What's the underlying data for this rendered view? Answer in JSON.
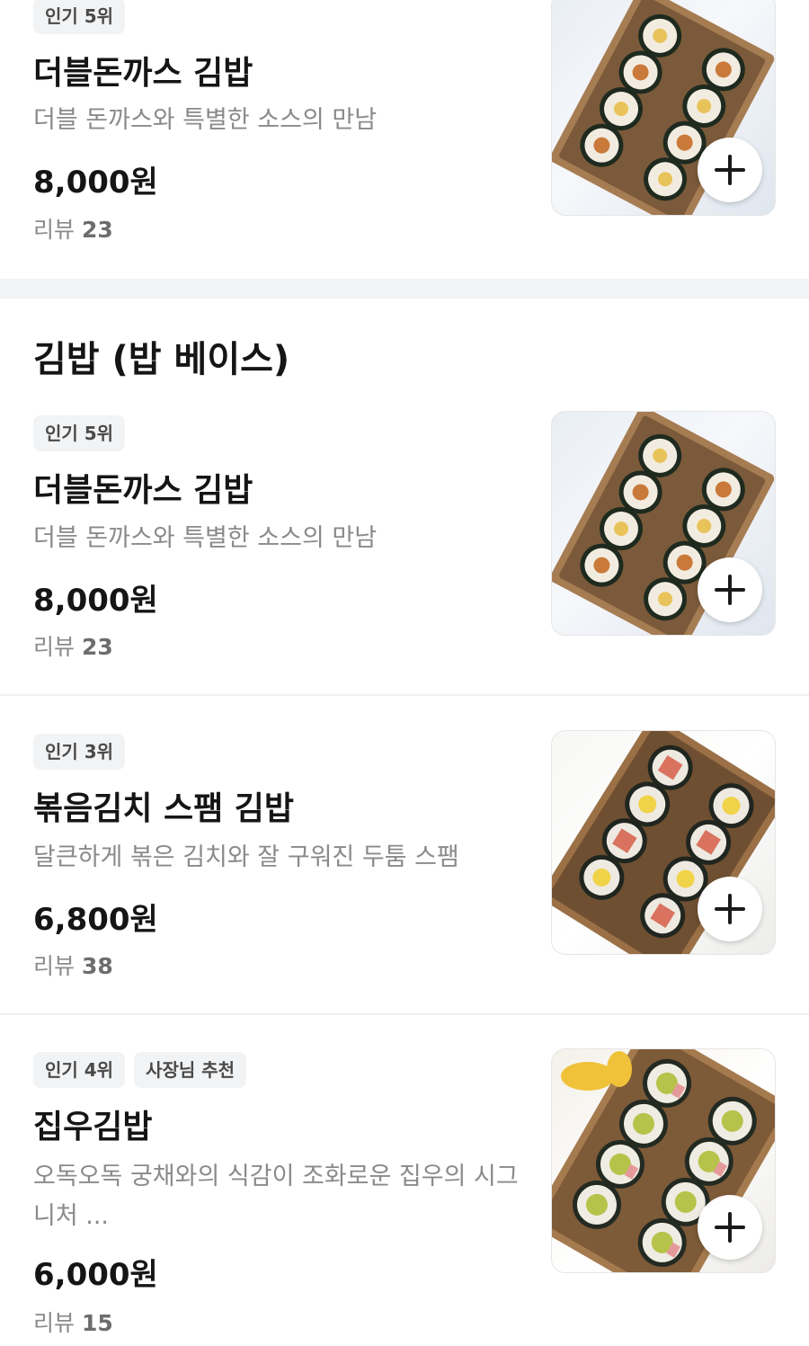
{
  "items_top": {
    "badge": "인기 5위",
    "name": "더블돈까스 김밥",
    "desc": "더블 돈까스와 특별한 소스의 만남",
    "price": "8,000원",
    "review_label": "리뷰",
    "review_count": "23"
  },
  "section": {
    "title": "김밥 (밥 베이스)"
  },
  "items": [
    {
      "badges": [
        "인기 5위"
      ],
      "name": "더블돈까스 김밥",
      "desc": "더블 돈까스와 특별한 소스의 만남",
      "price": "8,000원",
      "review_label": "리뷰",
      "review_count": "23"
    },
    {
      "badges": [
        "인기 3위"
      ],
      "name": "볶음김치 스팸 김밥",
      "desc": "달큰하게 볶은 김치와 잘 구워진 두툼 스팸",
      "price": "6,800원",
      "review_label": "리뷰",
      "review_count": "38"
    },
    {
      "badges": [
        "인기 4위",
        "사장님 추천"
      ],
      "name": "집우김밥",
      "desc": "오독오독 궁채와의 식감이 조화로운 집우의 시그니처 ...",
      "price": "6,000원",
      "review_label": "리뷰",
      "review_count": "15"
    }
  ],
  "icons": {
    "add": "plus-icon",
    "photo": "kimbap-photo"
  },
  "colors": {
    "badge_bg": "#f2f3f5",
    "text_primary": "#151515",
    "text_secondary": "#8a8a8a"
  }
}
